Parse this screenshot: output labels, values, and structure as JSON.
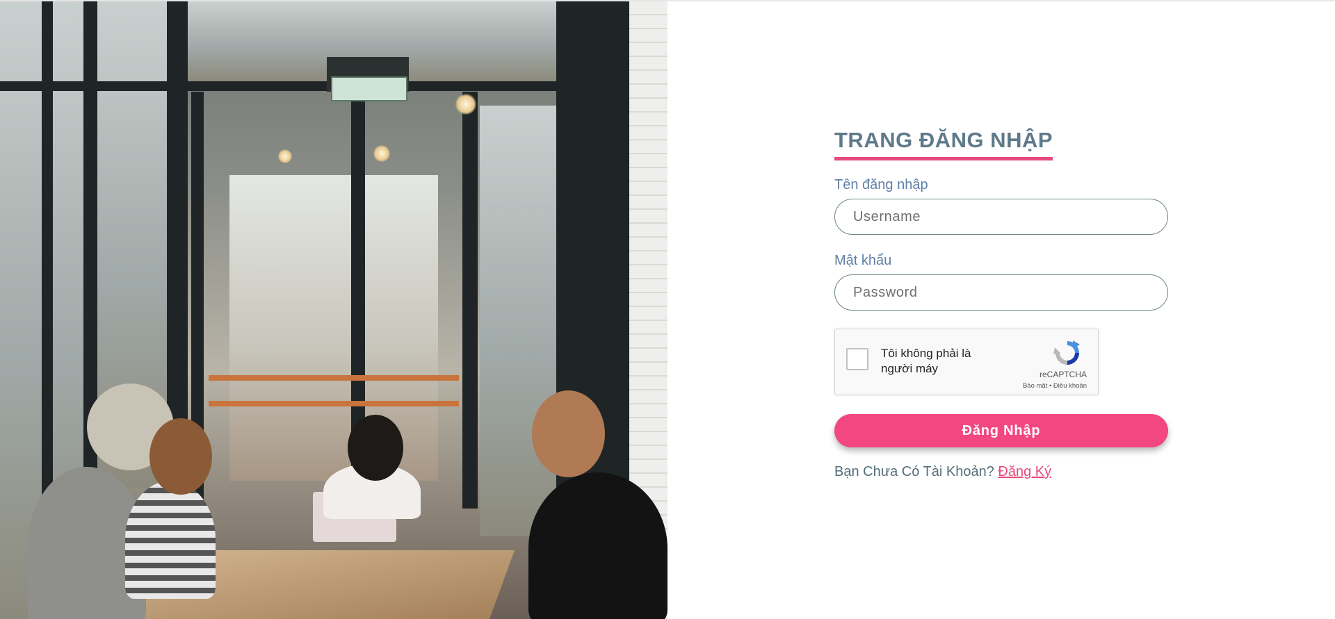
{
  "login": {
    "title": "TRANG ĐĂNG NHẬP",
    "username": {
      "label": "Tên đăng nhập",
      "placeholder": "Username",
      "value": ""
    },
    "password": {
      "label": "Mật khẩu",
      "placeholder": "Password",
      "value": ""
    },
    "captcha": {
      "label": "Tôi không phải là người máy",
      "brand": "reCAPTCHA",
      "links": "Bảo mật • Điều khoản",
      "checked": false
    },
    "submit_label": "Đăng Nhập",
    "register_prompt": "Bạn Chưa Có Tài Khoản?",
    "register_link": "Đăng Ký"
  },
  "colors": {
    "accent": "#f24781",
    "title": "#5e7a8a",
    "label": "#5f7fa6",
    "underline": "#e84a7b"
  },
  "icons": {
    "captcha": "recaptcha-logo-icon"
  }
}
